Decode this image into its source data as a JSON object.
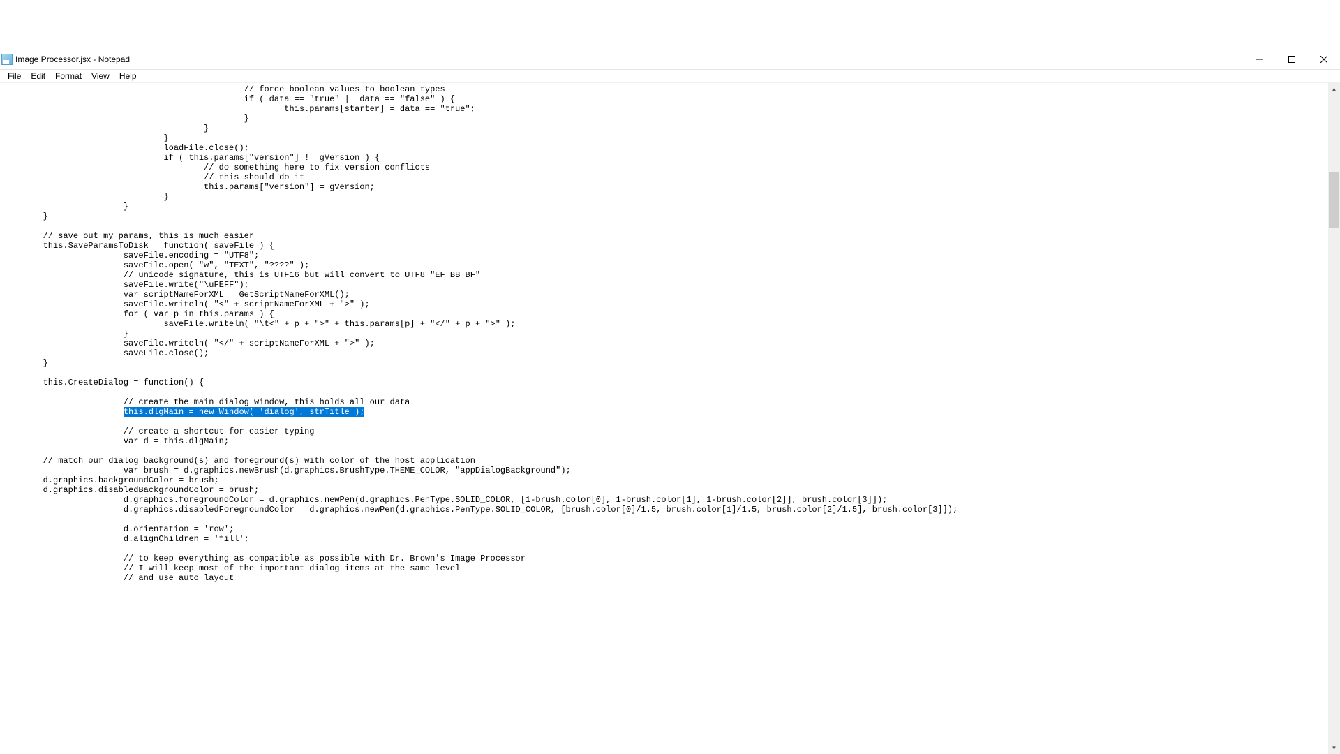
{
  "window": {
    "title": "Image Processor.jsx - Notepad"
  },
  "menu": {
    "file": "File",
    "edit": "Edit",
    "format": "Format",
    "view": "View",
    "help": "Help"
  },
  "code": {
    "before_selection": "\t\t\t\t\t\t// force boolean values to boolean types\n\t\t\t\t\t\tif ( data == \"true\" || data == \"false\" ) {\n\t\t\t\t\t\t\tthis.params[starter] = data == \"true\";\n\t\t\t\t\t\t}\n\t\t\t\t\t}\n\t\t\t\t}\n\t\t\t\tloadFile.close();\n\t\t\t\tif ( this.params[\"version\"] != gVersion ) {\n\t\t\t\t\t// do something here to fix version conflicts\n\t\t\t\t\t// this should do it\n\t\t\t\t\tthis.params[\"version\"] = gVersion;\n\t\t\t\t}\n\t\t\t}\n\t}\n\n\t// save out my params, this is much easier\n\tthis.SaveParamsToDisk = function( saveFile ) {\n\t\t\tsaveFile.encoding = \"UTF8\";\n\t\t\tsaveFile.open( \"w\", \"TEXT\", \"????\" );\n\t\t\t// unicode signature, this is UTF16 but will convert to UTF8 \"EF BB BF\"\n\t\t\tsaveFile.write(\"\\uFEFF\");\n\t\t\tvar scriptNameForXML = GetScriptNameForXML();\n\t\t\tsaveFile.writeln( \"<\" + scriptNameForXML + \">\" );\n\t\t\tfor ( var p in this.params ) {\n\t\t\t\tsaveFile.writeln( \"\\t<\" + p + \">\" + this.params[p] + \"</\" + p + \">\" );\n\t\t\t}\n\t\t\tsaveFile.writeln( \"</\" + scriptNameForXML + \">\" );\n\t\t\tsaveFile.close();\n\t}\n\n\tthis.CreateDialog = function() {\n\t\n\t\t\t// create the main dialog window, this holds all our data\n\t\t\t",
    "selection": "this.dlgMain = new Window( 'dialog', strTitle );",
    "after_selection": "\n\t\t\t\n\t\t\t// create a shortcut for easier typing\n\t\t\tvar d = this.dlgMain;\n\n\t// match our dialog background(s) and foreground(s) with color of the host application\n\t\t\tvar brush = d.graphics.newBrush(d.graphics.BrushType.THEME_COLOR, \"appDialogBackground\");\n\td.graphics.backgroundColor = brush;\n\td.graphics.disabledBackgroundColor = brush;\n\t\t\td.graphics.foregroundColor = d.graphics.newPen(d.graphics.PenType.SOLID_COLOR, [1-brush.color[0], 1-brush.color[1], 1-brush.color[2]], brush.color[3]]);\n\t\t\td.graphics.disabledForegroundColor = d.graphics.newPen(d.graphics.PenType.SOLID_COLOR, [brush.color[0]/1.5, brush.color[1]/1.5, brush.color[2]/1.5], brush.color[3]]);\n\n\t\t\td.orientation = 'row';\n\t\t\td.alignChildren = 'fill';\n\n\t\t\t// to keep everything as compatible as possible with Dr. Brown's Image Processor\n\t\t\t// I will keep most of the important dialog items at the same level\n\t\t\t// and use auto layout\n"
  }
}
